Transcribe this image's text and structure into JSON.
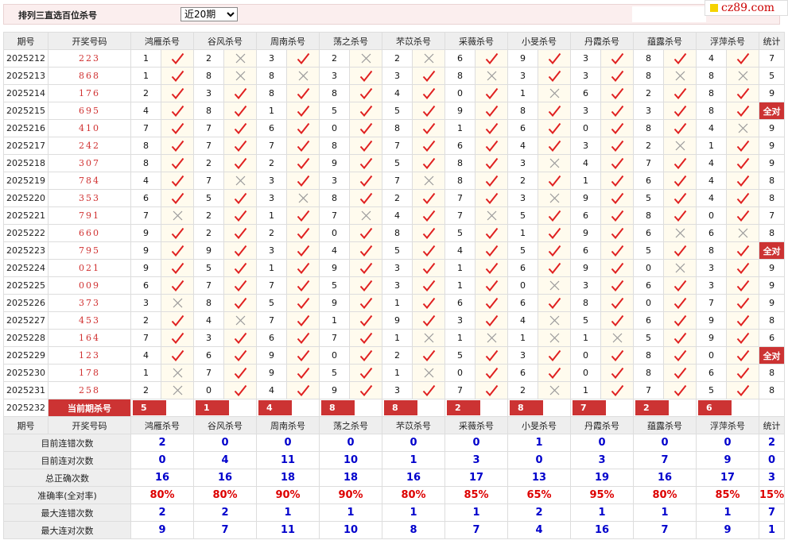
{
  "header": {
    "title": "排列三直选百位杀号",
    "period_select": "近20期",
    "logo": "cz89.com"
  },
  "table": {
    "col_issue": "期号",
    "col_draw": "开奖号码",
    "col_stats": "统计",
    "experts": [
      "鸿雁杀号",
      "谷风杀号",
      "周南杀号",
      "荡之杀号",
      "芣苡杀号",
      "采薇杀号",
      "小旻杀号",
      "丹霞杀号",
      "蕴露杀号",
      "浮萍杀号"
    ],
    "rows": [
      {
        "issue": "2025212",
        "draw": "223",
        "v": [
          1,
          2,
          3,
          2,
          2,
          6,
          9,
          3,
          8,
          4
        ],
        "ok": [
          1,
          0,
          1,
          0,
          0,
          1,
          1,
          1,
          1,
          1
        ],
        "stat": "7"
      },
      {
        "issue": "2025213",
        "draw": "868",
        "v": [
          1,
          8,
          8,
          3,
          3,
          8,
          3,
          3,
          8,
          8
        ],
        "ok": [
          1,
          0,
          0,
          1,
          1,
          0,
          1,
          1,
          0,
          0
        ],
        "stat": "5"
      },
      {
        "issue": "2025214",
        "draw": "176",
        "v": [
          2,
          3,
          8,
          8,
          4,
          0,
          1,
          6,
          2,
          8
        ],
        "ok": [
          1,
          1,
          1,
          1,
          1,
          1,
          0,
          1,
          1,
          1
        ],
        "stat": "9"
      },
      {
        "issue": "2025215",
        "draw": "695",
        "v": [
          4,
          8,
          1,
          5,
          5,
          9,
          8,
          3,
          3,
          8
        ],
        "ok": [
          1,
          1,
          1,
          1,
          1,
          1,
          1,
          1,
          1,
          1
        ],
        "stat": "全对"
      },
      {
        "issue": "2025216",
        "draw": "410",
        "v": [
          7,
          7,
          6,
          0,
          8,
          1,
          6,
          0,
          8,
          4
        ],
        "ok": [
          1,
          1,
          1,
          1,
          1,
          1,
          1,
          1,
          1,
          0
        ],
        "stat": "9"
      },
      {
        "issue": "2025217",
        "draw": "242",
        "v": [
          8,
          7,
          7,
          8,
          7,
          6,
          4,
          3,
          2,
          1
        ],
        "ok": [
          1,
          1,
          1,
          1,
          1,
          1,
          1,
          1,
          0,
          1
        ],
        "stat": "9"
      },
      {
        "issue": "2025218",
        "draw": "307",
        "v": [
          8,
          2,
          2,
          9,
          5,
          8,
          3,
          4,
          7,
          4
        ],
        "ok": [
          1,
          1,
          1,
          1,
          1,
          1,
          0,
          1,
          1,
          1
        ],
        "stat": "9"
      },
      {
        "issue": "2025219",
        "draw": "784",
        "v": [
          4,
          7,
          3,
          3,
          7,
          8,
          2,
          1,
          6,
          4
        ],
        "ok": [
          1,
          0,
          1,
          1,
          0,
          1,
          1,
          1,
          1,
          1
        ],
        "stat": "8"
      },
      {
        "issue": "2025220",
        "draw": "353",
        "v": [
          6,
          5,
          3,
          8,
          2,
          7,
          3,
          9,
          5,
          4
        ],
        "ok": [
          1,
          1,
          0,
          1,
          1,
          1,
          0,
          1,
          1,
          1
        ],
        "stat": "8"
      },
      {
        "issue": "2025221",
        "draw": "791",
        "v": [
          7,
          2,
          1,
          7,
          4,
          7,
          5,
          6,
          8,
          0
        ],
        "ok": [
          0,
          1,
          1,
          0,
          1,
          0,
          1,
          1,
          1,
          1
        ],
        "stat": "7"
      },
      {
        "issue": "2025222",
        "draw": "660",
        "v": [
          9,
          2,
          2,
          0,
          8,
          5,
          1,
          9,
          6,
          6
        ],
        "ok": [
          1,
          1,
          1,
          1,
          1,
          1,
          1,
          1,
          0,
          0
        ],
        "stat": "8"
      },
      {
        "issue": "2025223",
        "draw": "795",
        "v": [
          9,
          9,
          3,
          4,
          5,
          4,
          5,
          6,
          5,
          8
        ],
        "ok": [
          1,
          1,
          1,
          1,
          1,
          1,
          1,
          1,
          1,
          1
        ],
        "stat": "全对"
      },
      {
        "issue": "2025224",
        "draw": "021",
        "v": [
          9,
          5,
          1,
          9,
          3,
          1,
          6,
          9,
          0,
          3
        ],
        "ok": [
          1,
          1,
          1,
          1,
          1,
          1,
          1,
          1,
          0,
          1
        ],
        "stat": "9"
      },
      {
        "issue": "2025225",
        "draw": "009",
        "v": [
          6,
          7,
          7,
          5,
          3,
          1,
          0,
          3,
          6,
          3
        ],
        "ok": [
          1,
          1,
          1,
          1,
          1,
          1,
          0,
          1,
          1,
          1
        ],
        "stat": "9"
      },
      {
        "issue": "2025226",
        "draw": "373",
        "v": [
          3,
          8,
          5,
          9,
          1,
          6,
          6,
          8,
          0,
          7
        ],
        "ok": [
          0,
          1,
          1,
          1,
          1,
          1,
          1,
          1,
          1,
          1
        ],
        "stat": "9"
      },
      {
        "issue": "2025227",
        "draw": "453",
        "v": [
          2,
          4,
          7,
          1,
          9,
          3,
          4,
          5,
          6,
          9
        ],
        "ok": [
          1,
          0,
          1,
          1,
          1,
          1,
          0,
          1,
          1,
          1
        ],
        "stat": "8"
      },
      {
        "issue": "2025228",
        "draw": "164",
        "v": [
          7,
          3,
          6,
          7,
          1,
          1,
          1,
          1,
          5,
          9
        ],
        "ok": [
          1,
          1,
          1,
          1,
          0,
          0,
          0,
          0,
          1,
          1
        ],
        "stat": "6"
      },
      {
        "issue": "2025229",
        "draw": "123",
        "v": [
          4,
          6,
          9,
          0,
          2,
          5,
          3,
          0,
          8,
          0
        ],
        "ok": [
          1,
          1,
          1,
          1,
          1,
          1,
          1,
          1,
          1,
          1
        ],
        "stat": "全对"
      },
      {
        "issue": "2025230",
        "draw": "178",
        "v": [
          1,
          7,
          9,
          5,
          1,
          0,
          6,
          0,
          8,
          6
        ],
        "ok": [
          0,
          1,
          1,
          1,
          0,
          1,
          1,
          1,
          1,
          1
        ],
        "stat": "8"
      },
      {
        "issue": "2025231",
        "draw": "258",
        "v": [
          2,
          0,
          4,
          9,
          3,
          7,
          2,
          1,
          7,
          5
        ],
        "ok": [
          0,
          1,
          1,
          1,
          1,
          1,
          0,
          1,
          1,
          1
        ],
        "stat": "8"
      }
    ],
    "current": {
      "issue": "2025232",
      "label": "当前期杀号",
      "v": [
        "5",
        "1",
        "4",
        "8",
        "8",
        "2",
        "8",
        "7",
        "2",
        "6"
      ]
    },
    "summary": [
      {
        "label": "目前连错次数",
        "values": [
          "2",
          "0",
          "0",
          "0",
          "0",
          "0",
          "1",
          "0",
          "0",
          "0",
          "2"
        ]
      },
      {
        "label": "目前连对次数",
        "values": [
          "0",
          "4",
          "11",
          "10",
          "1",
          "3",
          "0",
          "3",
          "7",
          "9",
          "0"
        ]
      },
      {
        "label": "总正确次数",
        "values": [
          "16",
          "16",
          "18",
          "18",
          "16",
          "17",
          "13",
          "19",
          "16",
          "17",
          "3"
        ]
      },
      {
        "label": "准确率(全对率)",
        "values": [
          "80%",
          "80%",
          "90%",
          "90%",
          "80%",
          "85%",
          "65%",
          "95%",
          "80%",
          "85%",
          "15%"
        ]
      },
      {
        "label": "最大连错次数",
        "values": [
          "2",
          "2",
          "1",
          "1",
          "1",
          "1",
          "2",
          "1",
          "1",
          "1",
          "7"
        ]
      },
      {
        "label": "最大连对次数",
        "values": [
          "9",
          "7",
          "11",
          "10",
          "8",
          "7",
          "4",
          "16",
          "7",
          "9",
          "1"
        ]
      }
    ]
  },
  "colors": {
    "accent_red": "#cc3333",
    "summary_blue": "#0000cc",
    "rate_red": "#dd0000"
  }
}
